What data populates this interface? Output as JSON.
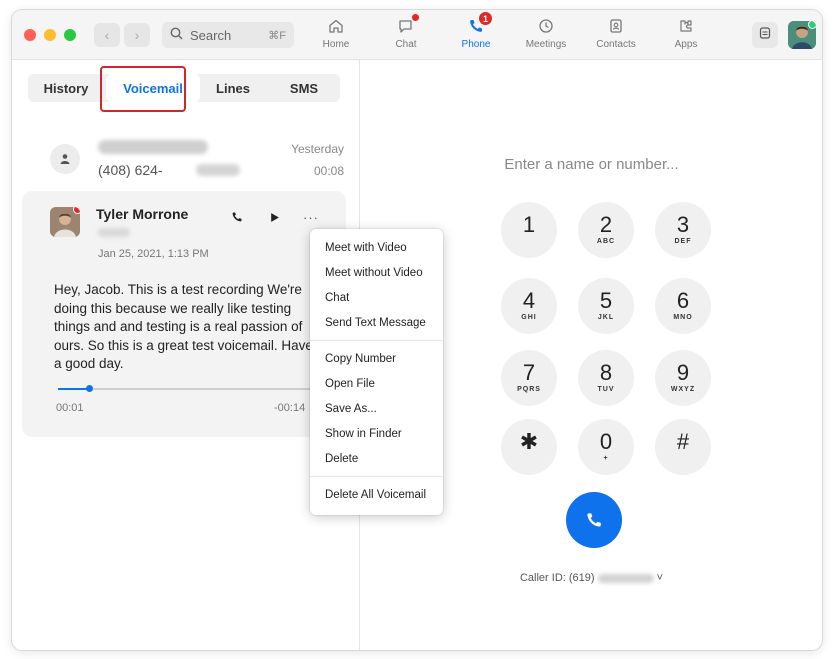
{
  "toolbar": {
    "search_label": "Search",
    "search_shortcut": "⌘F",
    "nav": [
      {
        "label": "Home",
        "icon": "home-icon"
      },
      {
        "label": "Chat",
        "icon": "chat-icon"
      },
      {
        "label": "Phone",
        "icon": "phone-icon",
        "badge": "1"
      },
      {
        "label": "Meetings",
        "icon": "clock-icon"
      },
      {
        "label": "Contacts",
        "icon": "contacts-icon"
      },
      {
        "label": "Apps",
        "icon": "apps-icon"
      }
    ],
    "active_nav": "Phone"
  },
  "tabs": [
    "History",
    "Voicemail",
    "Lines",
    "SMS"
  ],
  "selected_tab": "Voicemail",
  "voicemails": [
    {
      "number_prefix": "(408) 624-",
      "date": "Yesterday",
      "duration": "00:08"
    },
    {
      "name": "Tyler Morrone",
      "date": "Jan 25, 2021, 1:13 PM",
      "transcript": "Hey, Jacob. This is a test recording We're doing this because we really like testing things and and testing is a real passion of ours. So this is a great test voicemail. Have a good day.",
      "elapsed": "00:01",
      "remaining": "-00:14",
      "progress": 0.12
    }
  ],
  "context_menu": {
    "group1": [
      "Meet with Video",
      "Meet without Video",
      "Chat",
      "Send Text Message"
    ],
    "group2": [
      "Copy Number",
      "Open File",
      "Save As...",
      "Show in Finder",
      "Delete"
    ],
    "group3": [
      "Delete All Voicemail"
    ]
  },
  "dialpad": {
    "placeholder": "Enter a name or number...",
    "keys": [
      {
        "digit": "1",
        "letters": ""
      },
      {
        "digit": "2",
        "letters": "ABC"
      },
      {
        "digit": "3",
        "letters": "DEF"
      },
      {
        "digit": "4",
        "letters": "GHI"
      },
      {
        "digit": "5",
        "letters": "JKL"
      },
      {
        "digit": "6",
        "letters": "MNO"
      },
      {
        "digit": "7",
        "letters": "PQRS"
      },
      {
        "digit": "8",
        "letters": "TUV"
      },
      {
        "digit": "9",
        "letters": "WXYZ"
      },
      {
        "digit": "✱",
        "letters": ""
      },
      {
        "digit": "0",
        "letters": "+"
      },
      {
        "digit": "#",
        "letters": ""
      }
    ],
    "caller_id_label": "Caller ID: (619)",
    "caller_id_chevron": "˅"
  },
  "colors": {
    "accent": "#0e72ed",
    "alert": "#e02828",
    "highlight_box": "#d0262c"
  }
}
